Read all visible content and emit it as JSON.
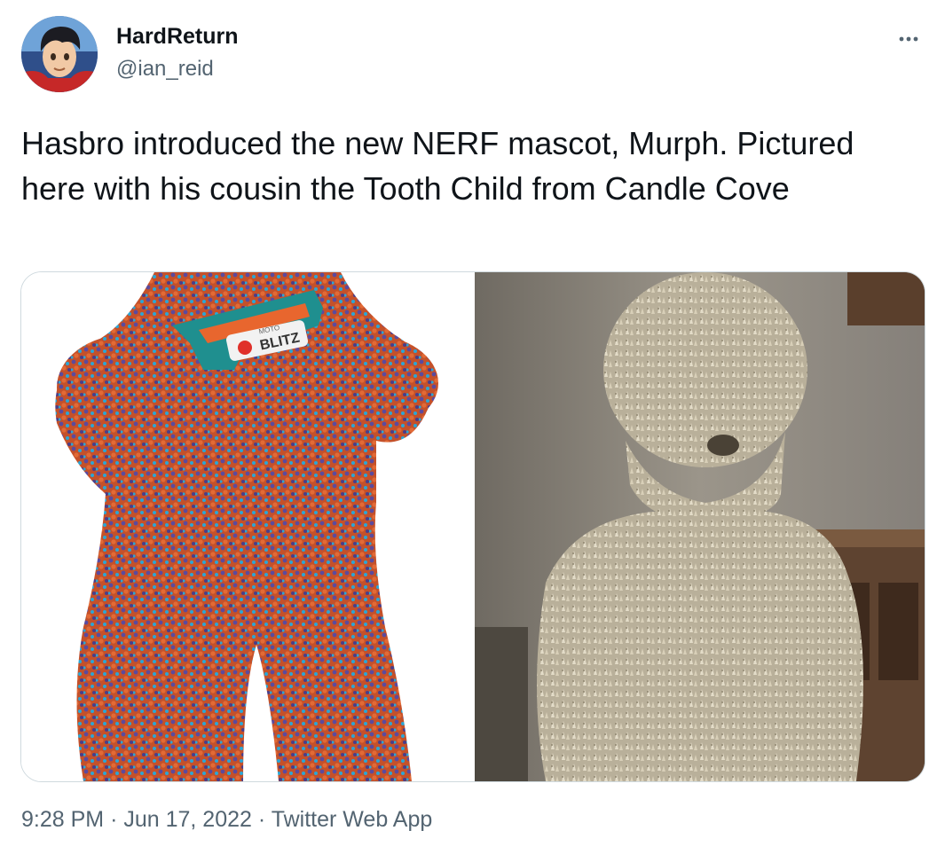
{
  "author": {
    "display_name": "HardReturn",
    "handle": "@ian_reid",
    "avatar_icon": "cartoon-avatar"
  },
  "menu": {
    "more_icon": "more-horizontal-icon"
  },
  "tweet": {
    "text": "Hasbro introduced the new NERF mascot, Murph. Pictured here with his cousin the Tooth Child from Candle Cove"
  },
  "media": {
    "left": {
      "blaster_label_small": "MOTO",
      "blaster_label": "BLITZ"
    }
  },
  "meta": {
    "time": "9:28 PM",
    "separator": "·",
    "date": "Jun 17, 2022",
    "source": "Twitter Web App"
  },
  "colors": {
    "text_primary": "#0f1419",
    "text_secondary": "#536471",
    "border": "#cfd9de",
    "nerf_orange": "#d9572c",
    "nerf_purple": "#5b4a9e",
    "nerf_blue": "#2aa6d6",
    "tooth_beige": "#cfc6b0"
  }
}
